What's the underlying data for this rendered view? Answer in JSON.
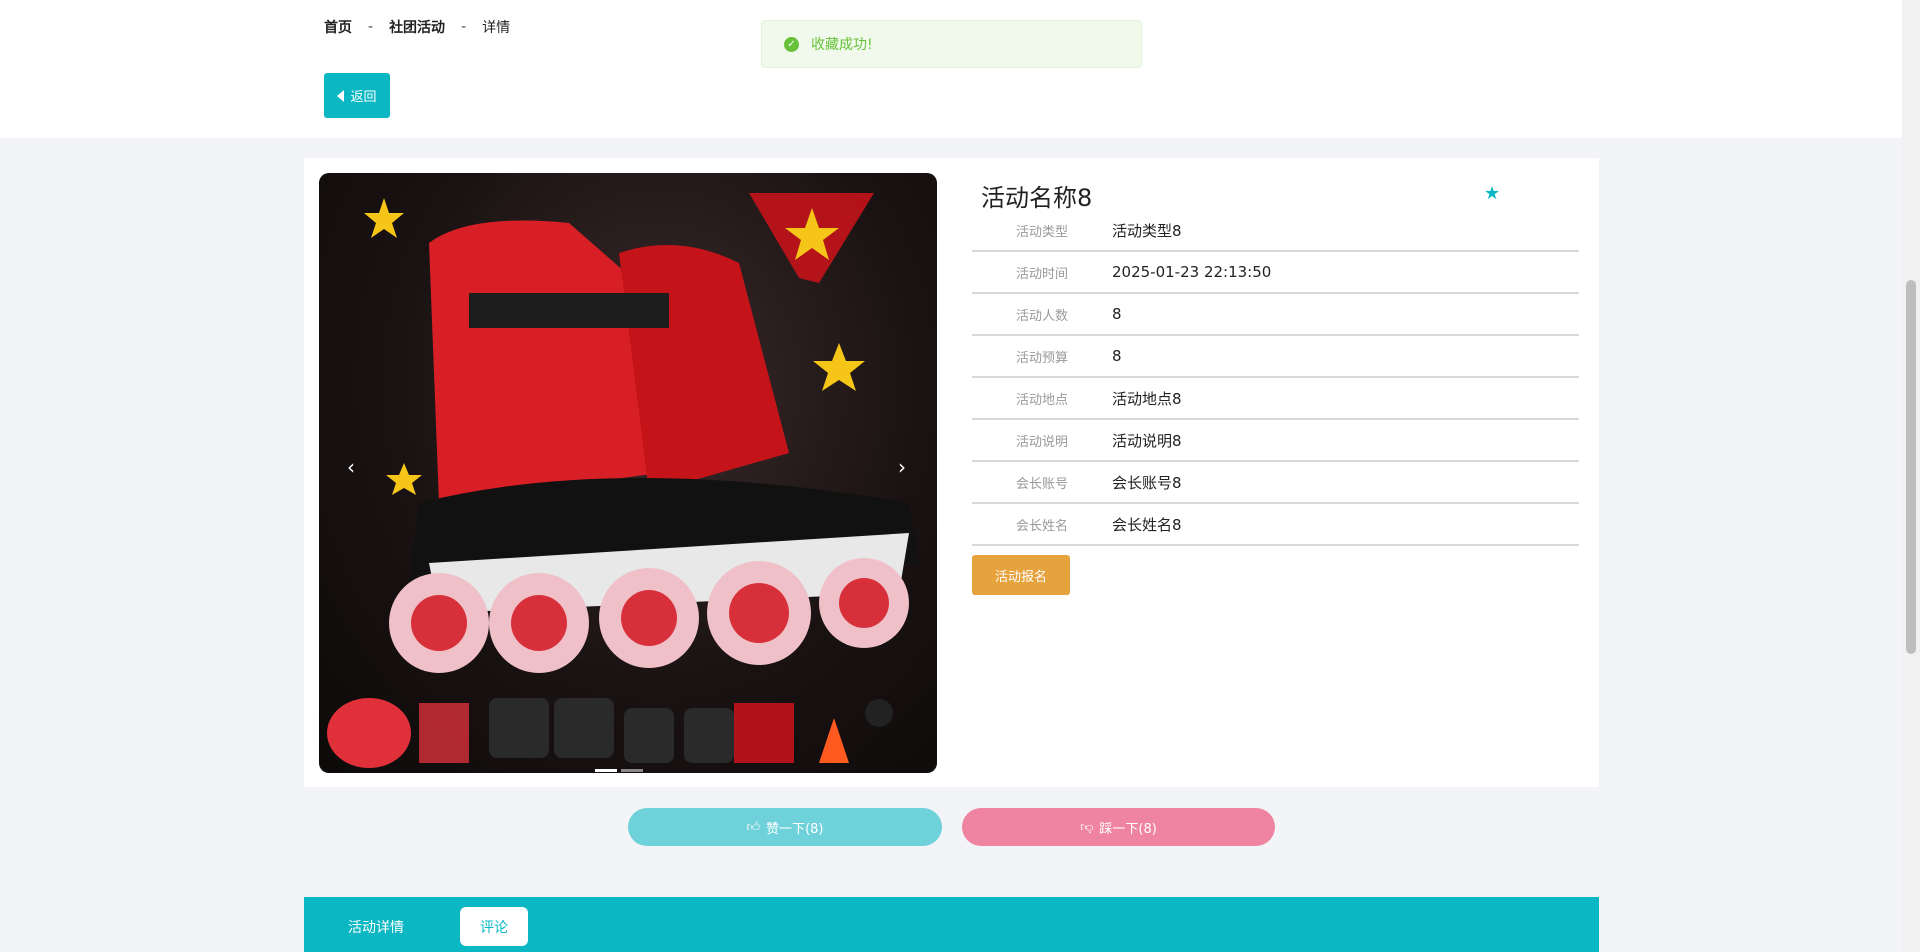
{
  "breadcrumb": {
    "home": "首页",
    "section": "社团活动",
    "current": "详情",
    "separator": "-"
  },
  "back_button": {
    "label": "返回"
  },
  "toast": {
    "message": "收藏成功!"
  },
  "activity": {
    "title": "活动名称8",
    "fields": [
      {
        "label": "活动类型",
        "value": "活动类型8"
      },
      {
        "label": "活动时间",
        "value": "2025-01-23 22:13:50"
      },
      {
        "label": "活动人数",
        "value": "8"
      },
      {
        "label": "活动预算",
        "value": "8"
      },
      {
        "label": "活动地点",
        "value": "活动地点8"
      },
      {
        "label": "活动说明",
        "value": "活动说明8"
      },
      {
        "label": "会长账号",
        "value": "会长账号8"
      },
      {
        "label": "会长姓名",
        "value": "会长姓名8"
      }
    ],
    "signup_label": "活动报名"
  },
  "carousel": {
    "prev": "‹",
    "next": "›"
  },
  "reactions": {
    "like_label": "赞一下(8)",
    "dislike_label": "踩一下(8)"
  },
  "tabs": [
    {
      "label": "活动详情",
      "active": false
    },
    {
      "label": "评论",
      "active": true
    }
  ],
  "colors": {
    "accent": "#0bb7c3",
    "signup": "#e6a23c",
    "like": "#6fd2da",
    "dislike": "#ee84a0",
    "toast_text": "#67c23a"
  },
  "icons": {
    "back": "caret-left-icon",
    "toast": "check-circle-icon",
    "favorite": "star-icon",
    "like": "thumbs-up-icon",
    "dislike": "thumbs-down-icon"
  }
}
